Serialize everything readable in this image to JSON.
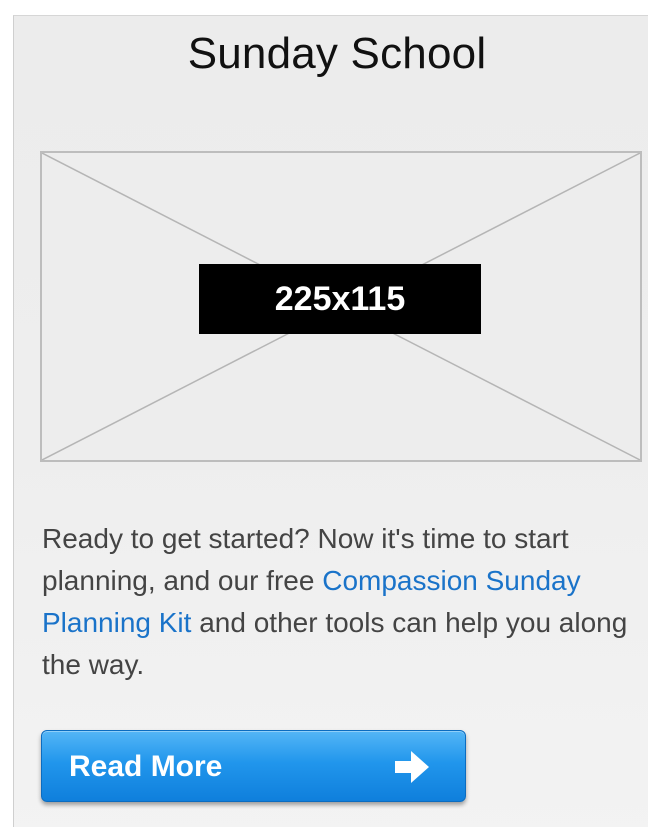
{
  "section": {
    "title": "Sunday School"
  },
  "image_placeholder": {
    "label": "225x115"
  },
  "description": {
    "text_before": "Ready to get started? Now it's time to start planning, and our free ",
    "link_text": "Compassion Sunday Planning Kit",
    "text_after": " and other tools can help you along the way."
  },
  "button": {
    "label": "Read More",
    "icon": "arrow-right-icon"
  },
  "colors": {
    "link": "#1a73c9",
    "button": "#1e8fe8",
    "text": "#444444"
  }
}
